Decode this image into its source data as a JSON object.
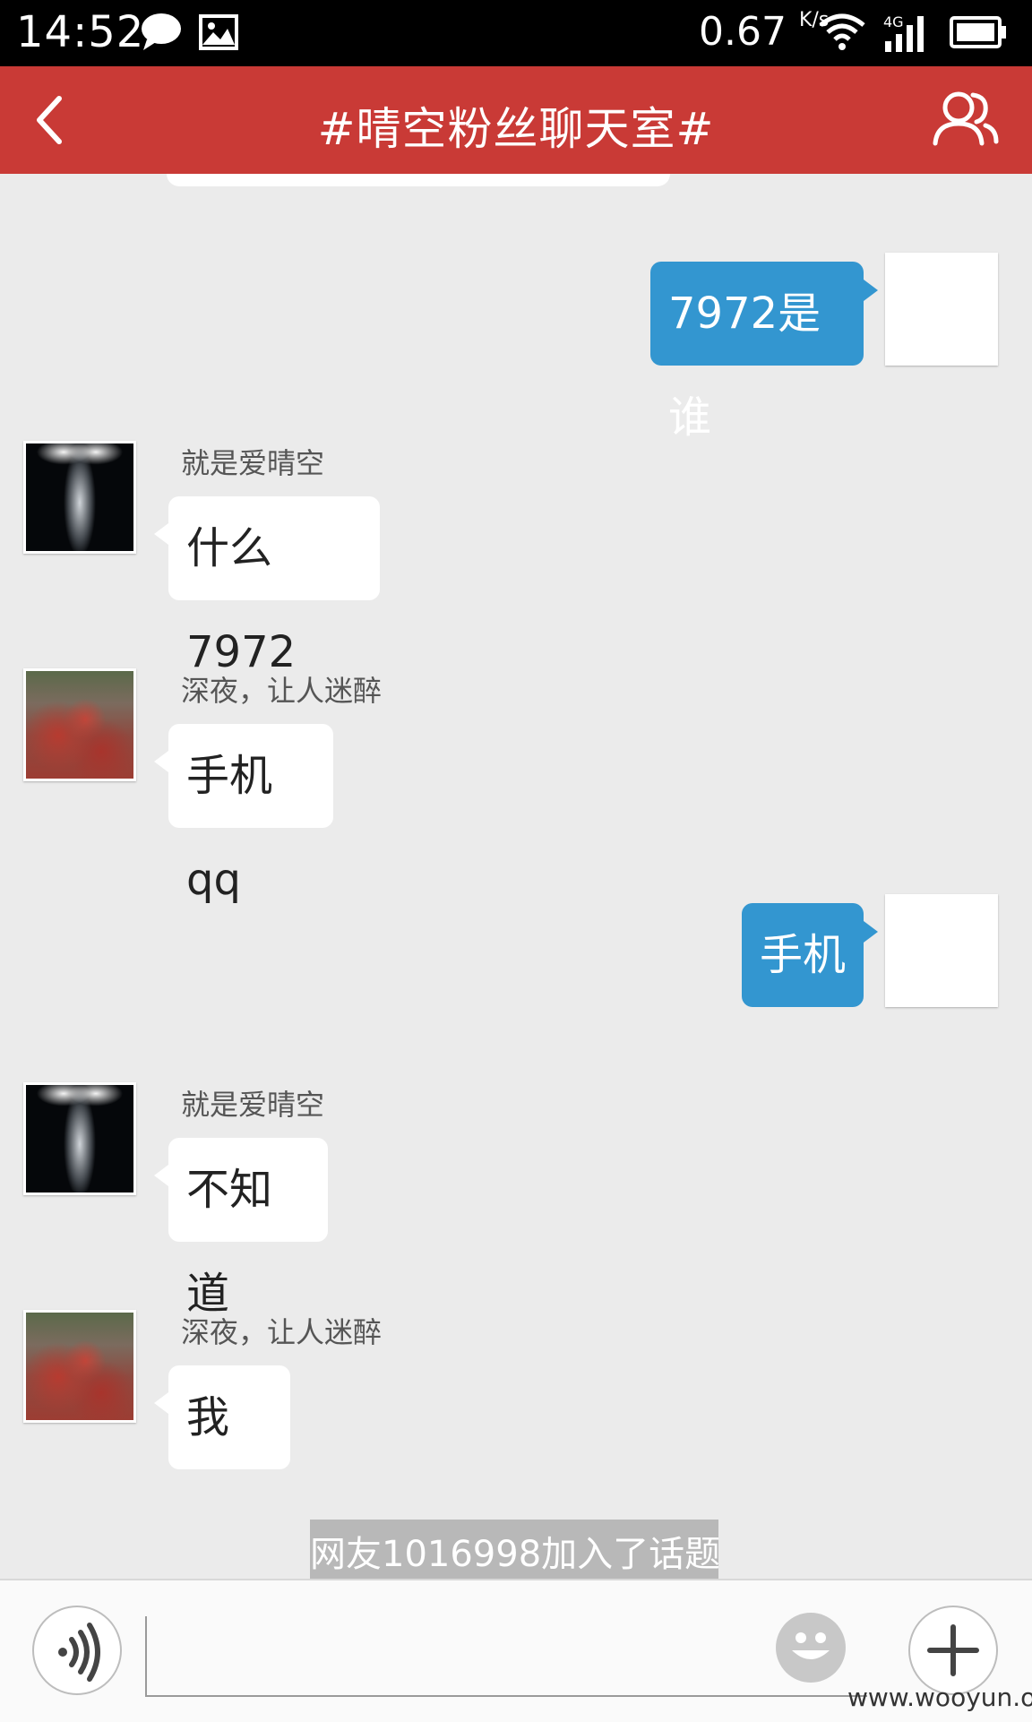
{
  "status_bar": {
    "time": "14:52",
    "speed": "0.67",
    "speed_unit": "K/s",
    "network": "4G",
    "icons": [
      "chat-bubble-icon",
      "image-icon",
      "wifi-icon",
      "signal-icon",
      "battery-icon"
    ]
  },
  "header": {
    "title": "#晴空粉丝聊天室#",
    "background_color": "#c93a36",
    "icons": [
      "back-arrow-icon",
      "members-icon"
    ]
  },
  "messages": [
    {
      "direction": "out",
      "text": "7972是谁"
    },
    {
      "direction": "in",
      "sender": "就是爱晴空",
      "text": "什么7972"
    },
    {
      "direction": "in",
      "sender": "深夜，让人迷醉",
      "text": "手机qq"
    },
    {
      "direction": "out",
      "text": "手机"
    },
    {
      "direction": "in",
      "sender": "就是爱晴空",
      "text": "不知道"
    },
    {
      "direction": "in",
      "sender": "深夜，让人迷醉",
      "text": "我"
    }
  ],
  "system_notice": "网友1016998加入了话题",
  "input_bar": {
    "placeholder": "",
    "icons": [
      "voice-icon",
      "emoji-icon",
      "plus-icon"
    ]
  },
  "watermark": "www.wooyun.org",
  "colors": {
    "outgoing_bubble": "#3396d0",
    "incoming_bubble": "#ffffff",
    "chat_background": "#ebebeb"
  }
}
